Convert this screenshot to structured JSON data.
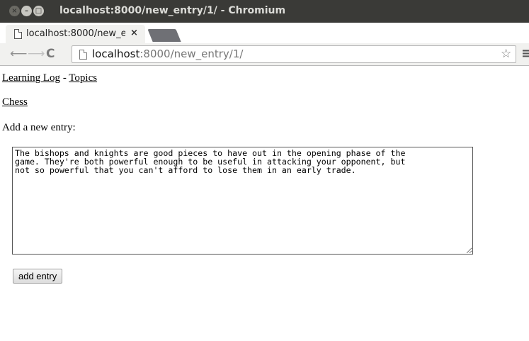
{
  "window": {
    "title": "localhost:8000/new_entry/1/ - Chromium",
    "close_glyph": "×",
    "minimize_glyph": "–",
    "maximize_glyph": "□"
  },
  "tab": {
    "title": "localhost:8000/new_e",
    "close_glyph": "×",
    "icon": "page-icon"
  },
  "toolbar": {
    "back_glyph": "⟵",
    "forward_glyph": "⟶",
    "reload_glyph": "C",
    "url_host": "localhost",
    "url_path": ":8000/new_entry/1/",
    "star_glyph": "☆",
    "menu_glyph": "≡"
  },
  "page": {
    "site_link": "Learning Log",
    "separator": " - ",
    "topics_link": "Topics",
    "topic_name": "Chess",
    "form_label": "Add a new entry:",
    "entry_text": "The bishops and knights are good pieces to have out in the opening phase of the\ngame. They're both powerful enough to be useful in attacking your opponent, but\nnot so powerful that you can't afford to lose them in an early trade.",
    "submit_label": "add entry"
  }
}
